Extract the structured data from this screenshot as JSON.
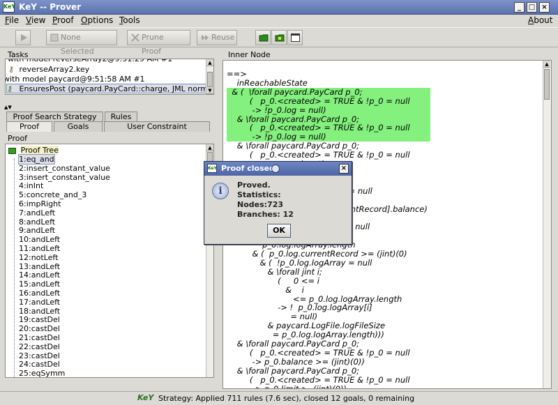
{
  "window": {
    "title": "KeY -- Prover",
    "app_icon": "KeY",
    "controls": [
      "_",
      "□",
      "×"
    ]
  },
  "menu": {
    "items": [
      {
        "label": "File",
        "mnemonic": "F",
        "rest": "ile"
      },
      {
        "label": "View",
        "mnemonic": "V",
        "rest": "iew"
      },
      {
        "label": "Proof",
        "mnemonic": "P",
        "rest": "roof"
      },
      {
        "label": "Options",
        "mnemonic": "O",
        "rest": "ptions"
      },
      {
        "label": "Tools",
        "mnemonic": "T",
        "rest": "ools"
      }
    ],
    "about": {
      "mnemonic": "A",
      "rest": "bout"
    }
  },
  "toolbar": {
    "run_icon": "play-icon",
    "none_selected": "None Selected",
    "prune_proof": "Prune Proof",
    "reuse": "Reuse"
  },
  "tasks": {
    "label": "Tasks",
    "rows": [
      "with model reverseArray2@9:51:29 AM #1",
      "reverseArray2.key",
      "with model paycard@9:51:58 AM #1",
      "EnsuresPost (paycard.PayCard::charge, JML normal_b"
    ]
  },
  "tabs": {
    "row1": [
      "Proof Search Strategy",
      "Rules"
    ],
    "row2": [
      "Proof",
      "Goals",
      "User Constraint"
    ]
  },
  "proof_panel": {
    "label": "Proof",
    "root": "Proof Tree",
    "nodes": [
      "1:eq_and",
      "2:insert_constant_value",
      "3:insert_constant_value",
      "4:inInt",
      "5:concrete_and_3",
      "6:impRight",
      "7:andLeft",
      "8:andLeft",
      "9:andLeft",
      "10:andLeft",
      "11:andLeft",
      "12:notLeft",
      "13:andLeft",
      "14:andLeft",
      "15:andLeft",
      "16:andLeft",
      "17:andLeft",
      "18:andLeft",
      "19:castDel",
      "20:castDel",
      "21:castDel",
      "22:castDel",
      "23:castDel",
      "24:castDel",
      "25:eqSymm"
    ]
  },
  "inner_node": {
    "label": "Inner Node",
    "lines": [
      "==>",
      "    inReachableState",
      "  & (  \\forall paycard.PayCard p_0;",
      "         (   p_0.<created> = TRUE & !p_0 = null",
      "          -> !p_0.log = null)",
      "    & \\forall paycard.PayCard p_0;",
      "         (   p_0.<created> = TRUE & !p_0 = null",
      "          -> !p_0.log = null)",
      "    & \\forall paycard.PayCard p_0;",
      "         (   p_0.<created> = TRUE & !p_0 = null",
      "                             length",
      "                             logFileSize)",
      "                             d p_0;",
      "                             RUE & !p_0 = null",
      "",
      "                            p_0.log.currentRecord].balance)",
      "                            d p_0;",
      "                            RUE & !p_0 = null",
      "                            Record",
      "              p_0.log.logArray.length",
      "          & (  p_0.log.currentRecord >= (jint)(0)",
      "             & (  !p_0.log.logArray = null",
      "                & \\forall jint i;",
      "                    (     0 <= i",
      "                       &    i",
      "                          <= p_0.log.logArray.length",
      "                    -> !  p_0.log.logArray[i]",
      "                         = null)",
      "                & paycard.LogFile.logFileSize",
      "                  = p_0.log.logArray.length)))",
      "    & \\forall paycard.PayCard p_0;",
      "         (   p_0.<created> = TRUE & !p_0 = null",
      "          -> p_0.balance >= (jint)(0))",
      "    & \\forall paycard.PayCard p_0;",
      "         (   p_0.<created> = TRUE & !p_0 = null",
      "          -> p_0.limit >  (jint)(0))"
    ],
    "highlighted": [
      2,
      3,
      4,
      5,
      6,
      7
    ]
  },
  "status": {
    "text": "Strategy: Applied 711 rules (7.6 sec),  closed 12 goals, 0 remaining"
  },
  "dialog": {
    "title": "Proof closed",
    "icon": "info-icon",
    "lines": [
      "Proved.",
      "Statistics:",
      "Nodes:723",
      "Branches: 12"
    ],
    "ok": "OK"
  },
  "colors": {
    "title_bar": "#5b72ae",
    "highlight": "#84f07e",
    "selection": "#dcdfe8"
  }
}
